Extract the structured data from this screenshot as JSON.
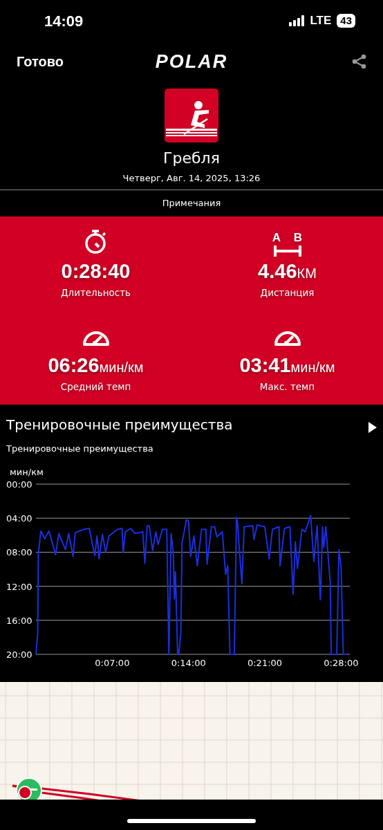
{
  "status_bar": {
    "time": "14:09",
    "network": "LTE",
    "battery": "43"
  },
  "header": {
    "done": "Готово",
    "logo": "POLAR"
  },
  "activity": {
    "name": "Гребля",
    "date": "Четверг, Авг. 14, 2025, 13:26"
  },
  "notes": "Примечания",
  "distance_icon": {
    "letters": [
      "A",
      "B"
    ]
  },
  "stats": [
    {
      "kind": "stopwatch",
      "value": "0:28:40",
      "label": "Длительность"
    },
    {
      "kind": "distance",
      "value": "4.46",
      "unit": "КМ",
      "label": "Дистанция"
    },
    {
      "kind": "gauge",
      "value": "06:26",
      "unit": "мин/км",
      "label": "Средний темп"
    },
    {
      "kind": "gauge",
      "value": "03:41",
      "unit": "мин/км",
      "label": "Макс. темп"
    }
  ],
  "section": {
    "title": "Тренировочные преимущества",
    "subtitle": "Тренировочные преимущества",
    "chart_data": {
      "type": "line",
      "grid": true,
      "ylabel": "мин/км",
      "xlim": [
        0,
        28.8
      ],
      "ylim": [
        20,
        0
      ],
      "xticks": [
        {
          "value": 7,
          "label": "0:07:00"
        },
        {
          "value": 14,
          "label": "0:14:00"
        },
        {
          "value": 21,
          "label": "0:21:00"
        },
        {
          "value": 28,
          "label": "0:28:00"
        }
      ],
      "yticks": [
        {
          "value": 0,
          "label": "00:00"
        },
        {
          "value": 4,
          "label": "04:00"
        },
        {
          "value": 8,
          "label": "08:00"
        },
        {
          "value": 12,
          "label": "12:00"
        },
        {
          "value": 16,
          "label": "16:00"
        },
        {
          "value": 20,
          "label": "20:00"
        }
      ],
      "x": [
        0,
        0.16,
        0.22,
        0.45,
        0.8,
        1.2,
        1.8,
        2.1,
        2.7,
        3.0,
        3.4,
        3.6,
        4.4,
        4.9,
        5.4,
        5.6,
        5.8,
        6.1,
        6.4,
        6.7,
        7.5,
        7.9,
        8.0,
        8.2,
        8.7,
        9.1,
        9.8,
        10.0,
        10.2,
        10.4,
        10.7,
        11.0,
        11.2,
        11.6,
        12.0,
        12.2,
        12.4,
        12.6,
        12.7,
        12.8,
        13.0,
        13.1,
        13.3,
        13.4,
        13.6,
        13.8,
        14.0,
        14.2,
        14.5,
        14.8,
        15.2,
        15.6,
        15.7,
        16.1,
        16.4,
        16.6,
        17.1,
        17.4,
        17.6,
        17.8,
        18.2,
        18.4,
        18.5,
        18.7,
        18.9,
        19.1,
        19.9,
        20.0,
        20.3,
        21.0,
        21.4,
        21.7,
        22.3,
        22.4,
        22.8,
        23.3,
        23.6,
        23.8,
        24.0,
        24.4,
        24.7,
        25.2,
        25.5,
        25.8,
        26.1,
        26.3,
        26.4,
        26.6,
        27.0,
        27.1,
        27.6,
        27.8,
        28.0,
        28.2,
        28.6
      ],
      "series": [
        {
          "color": "#1a2fe0",
          "values": [
            20,
            17.6,
            8.1,
            5.5,
            6.4,
            5.5,
            8.3,
            5.8,
            7.7,
            5.8,
            8.5,
            5.7,
            5.3,
            5.2,
            8.4,
            6.1,
            8.8,
            5.9,
            8.0,
            6.1,
            5.3,
            5.2,
            8.0,
            5.6,
            5.2,
            5.8,
            5.6,
            9.3,
            4.9,
            4.9,
            7.8,
            5.6,
            7.1,
            5.3,
            5.3,
            20,
            5.8,
            8.0,
            13.5,
            10.3,
            20,
            20,
            17.3,
            6.9,
            5.6,
            4.2,
            4.3,
            8.5,
            6.1,
            9.6,
            5.3,
            5.3,
            9.4,
            5.0,
            5.0,
            6.2,
            5.6,
            10.6,
            9.6,
            20,
            20,
            3.9,
            4.5,
            8.3,
            11.7,
            5.0,
            4.9,
            6.5,
            4.8,
            5.0,
            8.8,
            5.3,
            5.0,
            9.6,
            5.2,
            5.0,
            12.9,
            6.8,
            9.9,
            5.3,
            5.6,
            3.7,
            9.1,
            4.9,
            13.6,
            5.0,
            7.4,
            5.0,
            11.5,
            20,
            20,
            7.7,
            9.7,
            20,
            20
          ]
        }
      ]
    }
  }
}
